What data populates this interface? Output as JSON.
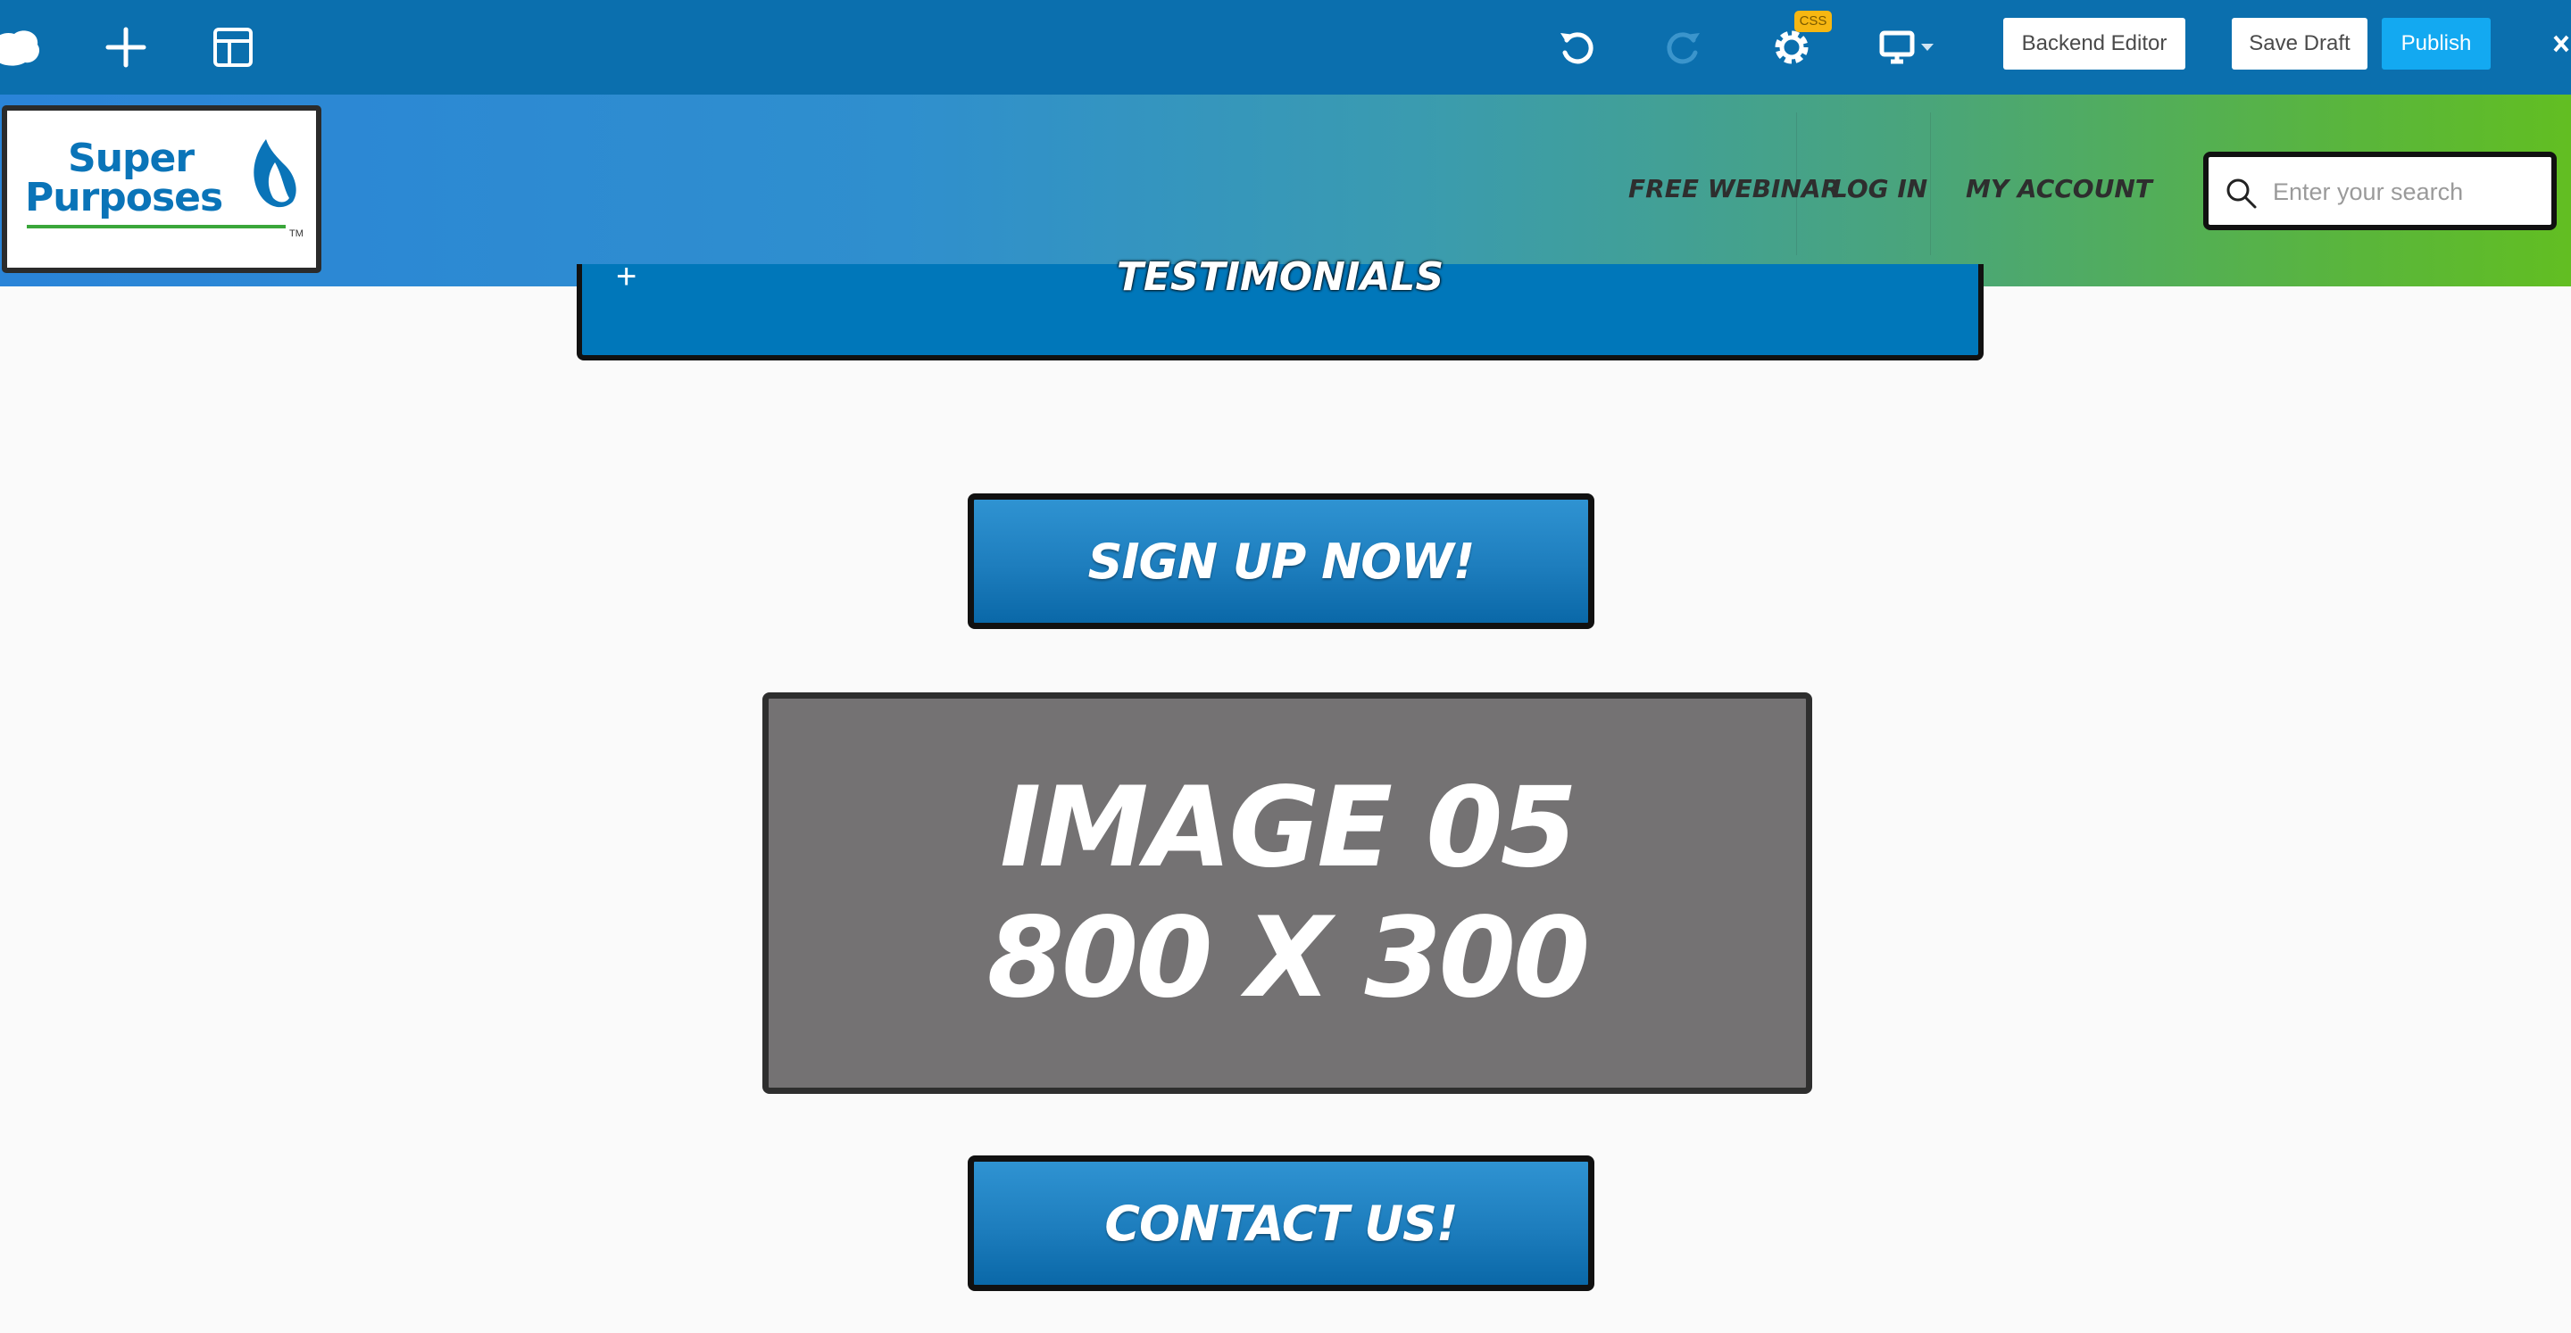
{
  "toolbar": {
    "icons": [
      "brand-logo-icon",
      "add-element-icon",
      "layout-icon",
      "undo-icon",
      "redo-icon",
      "settings-icon",
      "device-preview-icon"
    ],
    "css_badge": "CSS",
    "backend_editor_label": "Backend Editor",
    "save_draft_label": "Save Draft",
    "publish_label": "Publish",
    "colors": {
      "bar": "#0b6fae",
      "publish": "#13a9f1",
      "badge": "#f6b712"
    }
  },
  "header": {
    "logo_line1": "Super",
    "logo_line2": "Purposes",
    "logo_tm": "TM",
    "nav": [
      "FREE WEBINAR",
      "LOG IN",
      "MY ACCOUNT"
    ],
    "search_placeholder": "Enter your search"
  },
  "content": {
    "accordion_toggle": "+",
    "accordion_title": "TESTIMONIALS",
    "signup_label": "SIGN UP NOW!",
    "image_line1": "IMAGE 05",
    "image_line2": "800 X 300",
    "contact_label": "CONTACT US!"
  }
}
